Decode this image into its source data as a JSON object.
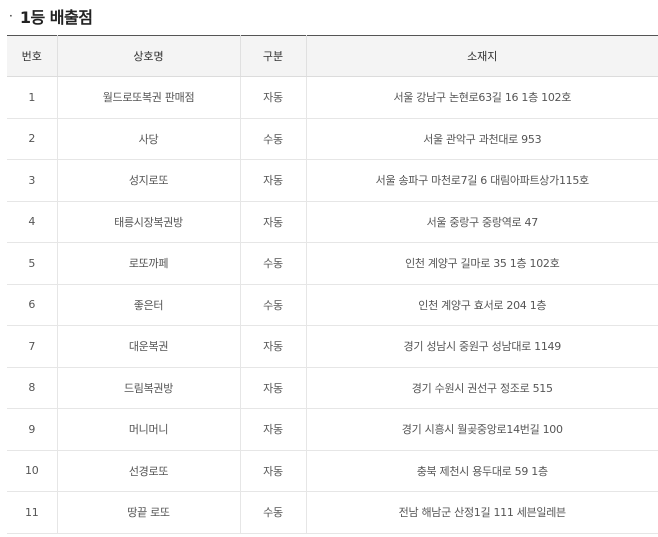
{
  "section": {
    "bullet": "·",
    "title": "1등 배출점"
  },
  "table": {
    "headers": [
      "번호",
      "상호명",
      "구분",
      "소재지"
    ],
    "rows": [
      {
        "no": "1",
        "name": "월드로또복권 판매점",
        "type": "자동",
        "address": "서울 강남구 논현로63길 16 1층 102호"
      },
      {
        "no": "2",
        "name": "사당",
        "type": "수동",
        "address": "서울 관악구 과천대로 953"
      },
      {
        "no": "3",
        "name": "성지로또",
        "type": "자동",
        "address": "서울 송파구 마천로7길 6 대림아파트상가115호"
      },
      {
        "no": "4",
        "name": "태릉시장복권방",
        "type": "자동",
        "address": "서울 중랑구 중랑역로 47"
      },
      {
        "no": "5",
        "name": "로또까페",
        "type": "수동",
        "address": "인천 계양구 길마로 35 1층 102호"
      },
      {
        "no": "6",
        "name": "좋은터",
        "type": "수동",
        "address": "인천 계양구 효서로 204 1층"
      },
      {
        "no": "7",
        "name": "대운복권",
        "type": "자동",
        "address": "경기 성남시 중원구 성남대로 1149"
      },
      {
        "no": "8",
        "name": "드림복권방",
        "type": "자동",
        "address": "경기 수원시 권선구 정조로 515"
      },
      {
        "no": "9",
        "name": "머니머니",
        "type": "자동",
        "address": "경기 시흥시 월곶중앙로14번길 100"
      },
      {
        "no": "10",
        "name": "선경로또",
        "type": "자동",
        "address": "충북 제천시 용두대로 59 1층"
      },
      {
        "no": "11",
        "name": "땅끝 로또",
        "type": "수동",
        "address": "전남 해남군 산정1길 111 세븐일레븐"
      }
    ]
  }
}
